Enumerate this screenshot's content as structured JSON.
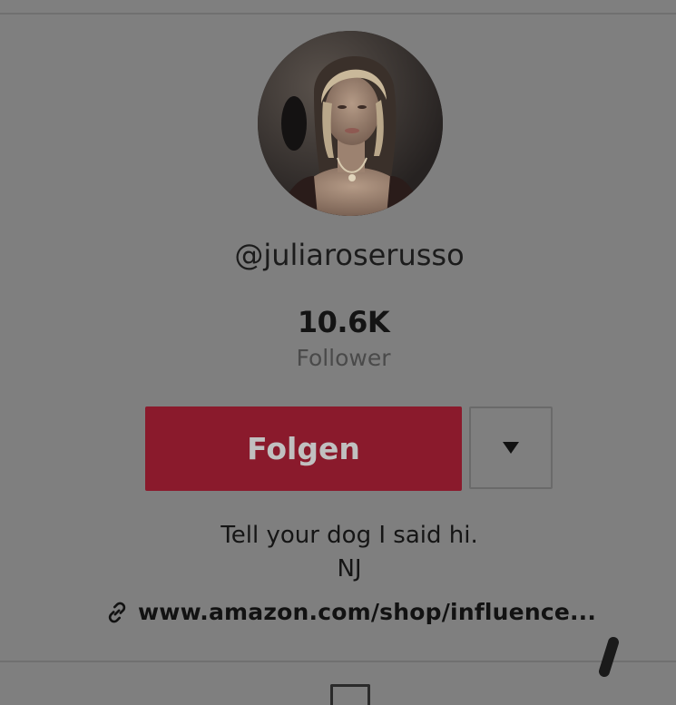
{
  "profile": {
    "username": "@juliaroserusso",
    "follower_count": "10.6K",
    "follower_label": "Follower",
    "follow_label": "Folgen",
    "bio_line_1": "Tell your dog I said hi.",
    "bio_line_2": "NJ",
    "link_text": "www.amazon.com/shop/influence...",
    "avatar_alt": "Profile picture"
  },
  "icons": {
    "more": "triangle-down-icon",
    "link": "link-icon",
    "tab": "grid-icon"
  },
  "colors": {
    "overlay_background": "#7f7f7f",
    "follow_button": "#8a1a2c",
    "follow_text": "#c0c0c0",
    "text": "#1a1a1a"
  }
}
